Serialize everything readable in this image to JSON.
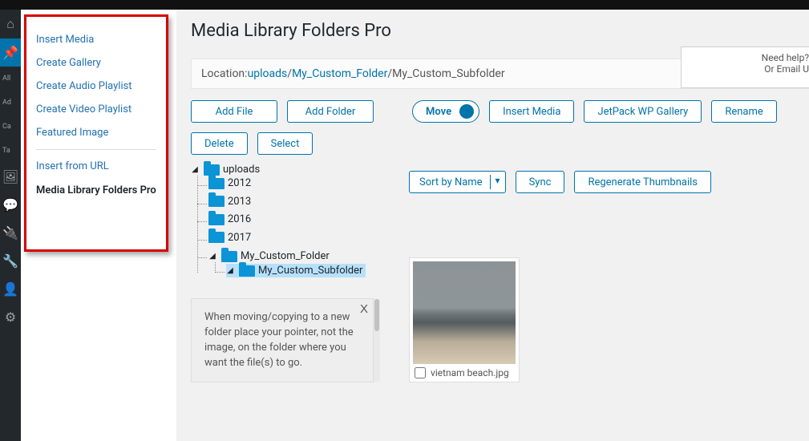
{
  "page_title": "Media Library Folders Pro",
  "help": {
    "line1": "Need help?",
    "line2": "Or Email U"
  },
  "side_menu": {
    "items": [
      "Insert Media",
      "Create Gallery",
      "Create Audio Playlist",
      "Create Video Playlist",
      "Featured Image"
    ],
    "url_item": "Insert from URL",
    "active": "Media Library Folders Pro"
  },
  "admin_rail": {
    "items": [
      "All",
      "Ad",
      "Ca",
      "Ta"
    ]
  },
  "location": {
    "label": "Location: ",
    "parts": [
      "uploads",
      "My_Custom_Folder",
      "My_Custom_Subfolder"
    ]
  },
  "buttons": {
    "add_file": "Add File",
    "add_folder": "Add Folder",
    "move": "Move",
    "insert_media": "Insert Media",
    "jetpack": "JetPack WP Gallery",
    "rename": "Rename",
    "delete": "Delete",
    "select": "Select",
    "sort": "Sort by Name",
    "sync": "Sync",
    "regen": "Regenerate Thumbnails"
  },
  "tree": {
    "root": "uploads",
    "years": [
      "2012",
      "2013",
      "2016",
      "2017"
    ],
    "custom": "My_Custom_Folder",
    "sub": "My_Custom_Subfolder"
  },
  "hint": {
    "close": "X",
    "text": "When moving/copying to a new folder place your pointer, not the image, on the folder where you want the file(s) to go."
  },
  "thumbnail": {
    "caption": "vietnam beach.jpg"
  }
}
